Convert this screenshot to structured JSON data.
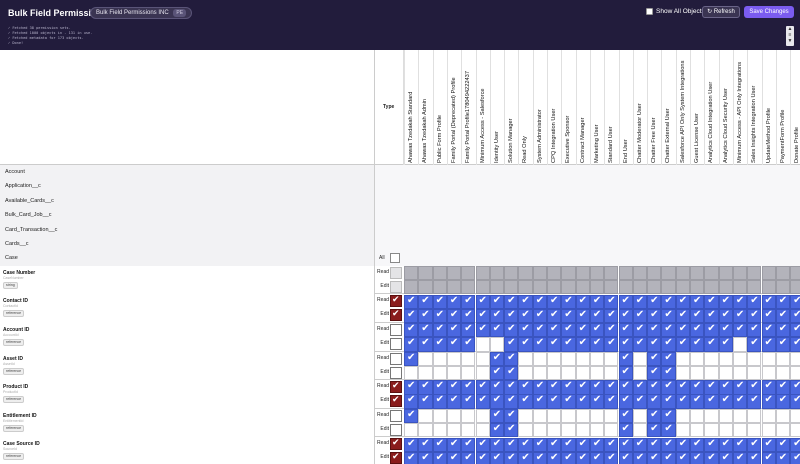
{
  "header": {
    "title": "Bulk Field Permissions",
    "org_name": "Bulk Field Permissions INC",
    "org_env": "PE",
    "show_all_label": "Show All Objects",
    "refresh_label": "↻ Refresh",
    "save_label": "Save Changes",
    "log_lines": [
      "✓ Fetched 38 permission sets.",
      "✓ Fetched 1000 objects in - 131 in use.",
      "✓ Fetched metadata for 173 objects.",
      "✓ Done!"
    ]
  },
  "columns": {
    "type_label": "Type",
    "profiles": [
      "Ahawas Tzedakah Standard",
      "Ahawas Tzedakah Admin",
      "Public Form Profile",
      "Family Portal (Deprecated) Profile",
      "Family Portal Profile1780494222437",
      "Minimum Access - Salesforce",
      "Identity User",
      "Solution Manager",
      "Read Only",
      "System Administrator",
      "CPQ Integration User",
      "Executive Sponsor",
      "Contract Manager",
      "Marketing User",
      "Standard User",
      "End User",
      "Chatter Moderator User",
      "Chatter Free User",
      "Chatter External User",
      "Salesforce API Only System Integrations",
      "Guest License User",
      "Analytics Cloud Integration User",
      "Analytics Cloud Security User",
      "Minimum Access - API Only Integrations",
      "Sales Insights Integration User",
      "UpdateMethod Profile",
      "PaymentForm Profile",
      "Donate Profile"
    ]
  },
  "objects": [
    {
      "name": "Account"
    },
    {
      "name": "Application__c"
    },
    {
      "name": "Available_Cards__c"
    },
    {
      "name": "Bulk_Card_Job__c"
    },
    {
      "name": "Card_Transaction__c"
    },
    {
      "name": "Cards__c"
    },
    {
      "name": "Case"
    }
  ],
  "case_all_label": "All",
  "read_label": "Read",
  "edit_label": "Edit",
  "fields": [
    {
      "name": "Case Number",
      "api": "CaseNumber",
      "type": "string",
      "read_master": "disabled",
      "edit_master": "disabled",
      "read": "dddddddddddddddddddddddddddd",
      "edit": "dddddddddddddddddddddddddddd"
    },
    {
      "name": "Contact ID",
      "api": "ContactId",
      "type": "reference",
      "read_master": "on",
      "edit_master": "on",
      "read": "1111111111111111111111111111",
      "edit": "1111111111111111111111111111"
    },
    {
      "name": "Account ID",
      "api": "AccountId",
      "type": "reference",
      "read_master": "off",
      "edit_master": "off",
      "read": "1111111111111111111111111111",
      "edit": "1111100111111111111111101111"
    },
    {
      "name": "Asset ID",
      "api": "AssetId",
      "type": "reference",
      "read_master": "off",
      "edit_master": "off",
      "read": "1000001100000001011000000000",
      "edit": "0000001100000001011000000000"
    },
    {
      "name": "Product ID",
      "api": "ProductId",
      "type": "reference",
      "read_master": "on",
      "edit_master": "on",
      "read": "1111111111111111111111111111",
      "edit": "1111111111111111111111111111"
    },
    {
      "name": "Entitlement ID",
      "api": "EntitlementId",
      "type": "reference",
      "read_master": "off",
      "edit_master": "off",
      "read": "1000001100000001011000000000",
      "edit": "0000001100000001011000000000"
    },
    {
      "name": "Case Source ID",
      "api": "SourceId",
      "type": "reference",
      "read_master": "on",
      "edit_master": "on",
      "read": "1111111111111111111111111111",
      "edit": "1111111111111111111111111111"
    }
  ]
}
